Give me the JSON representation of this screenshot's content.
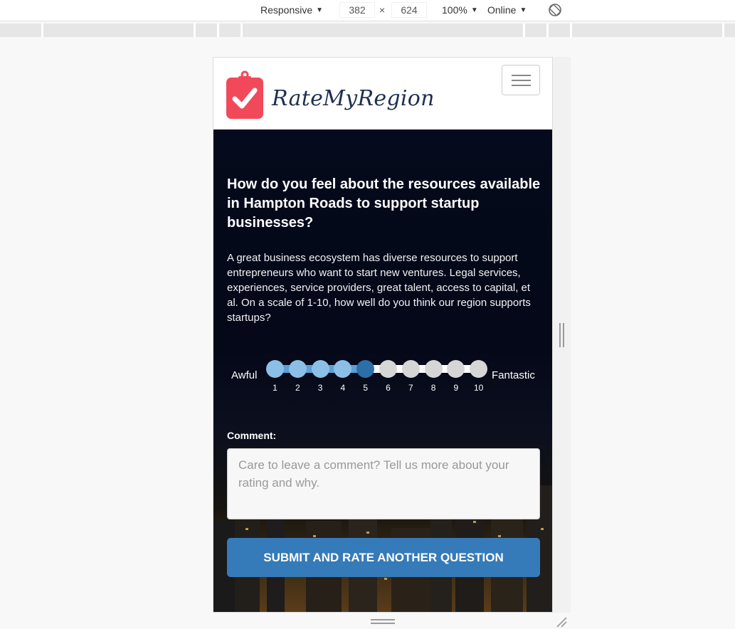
{
  "devtools": {
    "device": "Responsive",
    "width": "382",
    "times": "×",
    "height": "624",
    "zoom": "100%",
    "network": "Online"
  },
  "site": {
    "logo_text": "RateMyRegion",
    "brand_color": "#f2495a"
  },
  "question": {
    "title": "How do you feel about the resources available in Hampton Roads to support startup businesses?",
    "description": "A great business ecosystem has diverse resources to support entrepreneurs who want to start new ventures. Legal services, experiences, service providers, great talent, access to capital, et al. On a scale of 1-10, how well do you think our region supports startups?"
  },
  "rating": {
    "low_label": "Awful",
    "high_label": "Fantastic",
    "selected": 5,
    "options": [
      "1",
      "2",
      "3",
      "4",
      "5",
      "6",
      "7",
      "8",
      "9",
      "10"
    ],
    "colors": {
      "filled": "#8cbfe6",
      "selected": "#2c6ea8",
      "empty": "#d6d6d6",
      "track_fill": "#5d9fd6"
    }
  },
  "comment": {
    "label": "Comment:",
    "placeholder": "Care to leave a comment? Tell us more about your rating and why."
  },
  "submit": {
    "label": "SUBMIT AND RATE ANOTHER QUESTION",
    "color": "#357ab9"
  }
}
